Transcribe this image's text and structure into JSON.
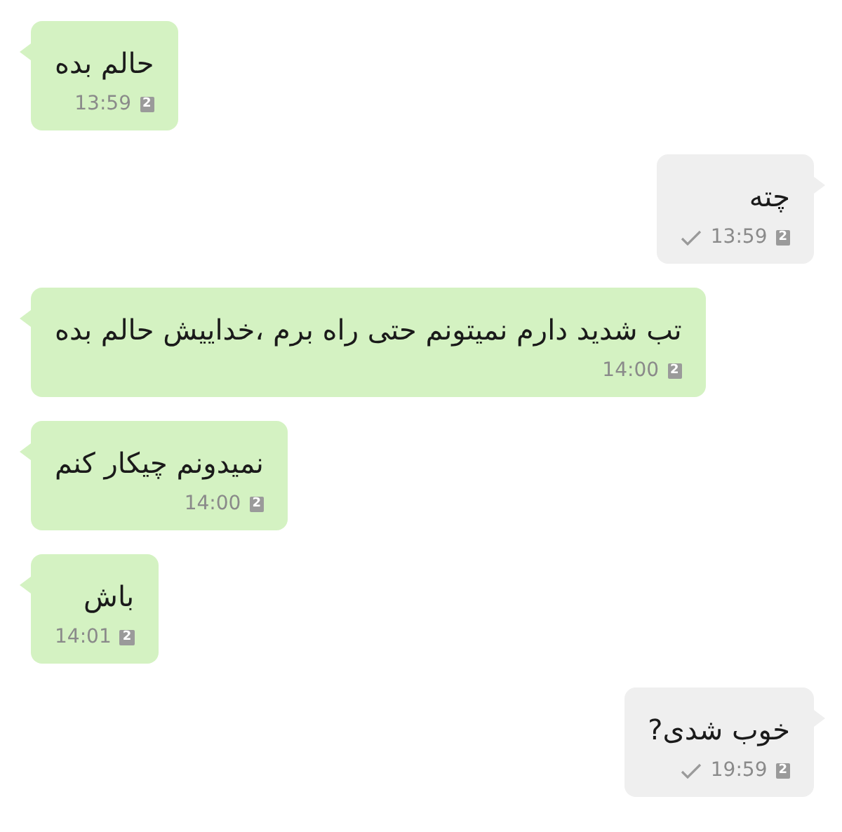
{
  "messages": [
    {
      "kind": "incoming",
      "text": "حالم بده",
      "time": "13:59",
      "sim": "2",
      "sent": false
    },
    {
      "kind": "outgoing",
      "text": "چته",
      "time": "13:59",
      "sim": "2",
      "sent": true
    },
    {
      "kind": "incoming",
      "text": "تب شدید دارم نمیتونم حتی راه برم ،خداییش حالم بده",
      "time": "14:00",
      "sim": "2",
      "sent": false
    },
    {
      "kind": "incoming",
      "text": "نمیدونم چیکار کنم",
      "time": "14:00",
      "sim": "2",
      "sent": false
    },
    {
      "kind": "incoming",
      "text": "باش",
      "time": "14:01",
      "sim": "2",
      "sent": false
    },
    {
      "kind": "outgoing",
      "text": "خوب شدی?",
      "time": "19:59",
      "sim": "2",
      "sent": true
    }
  ]
}
